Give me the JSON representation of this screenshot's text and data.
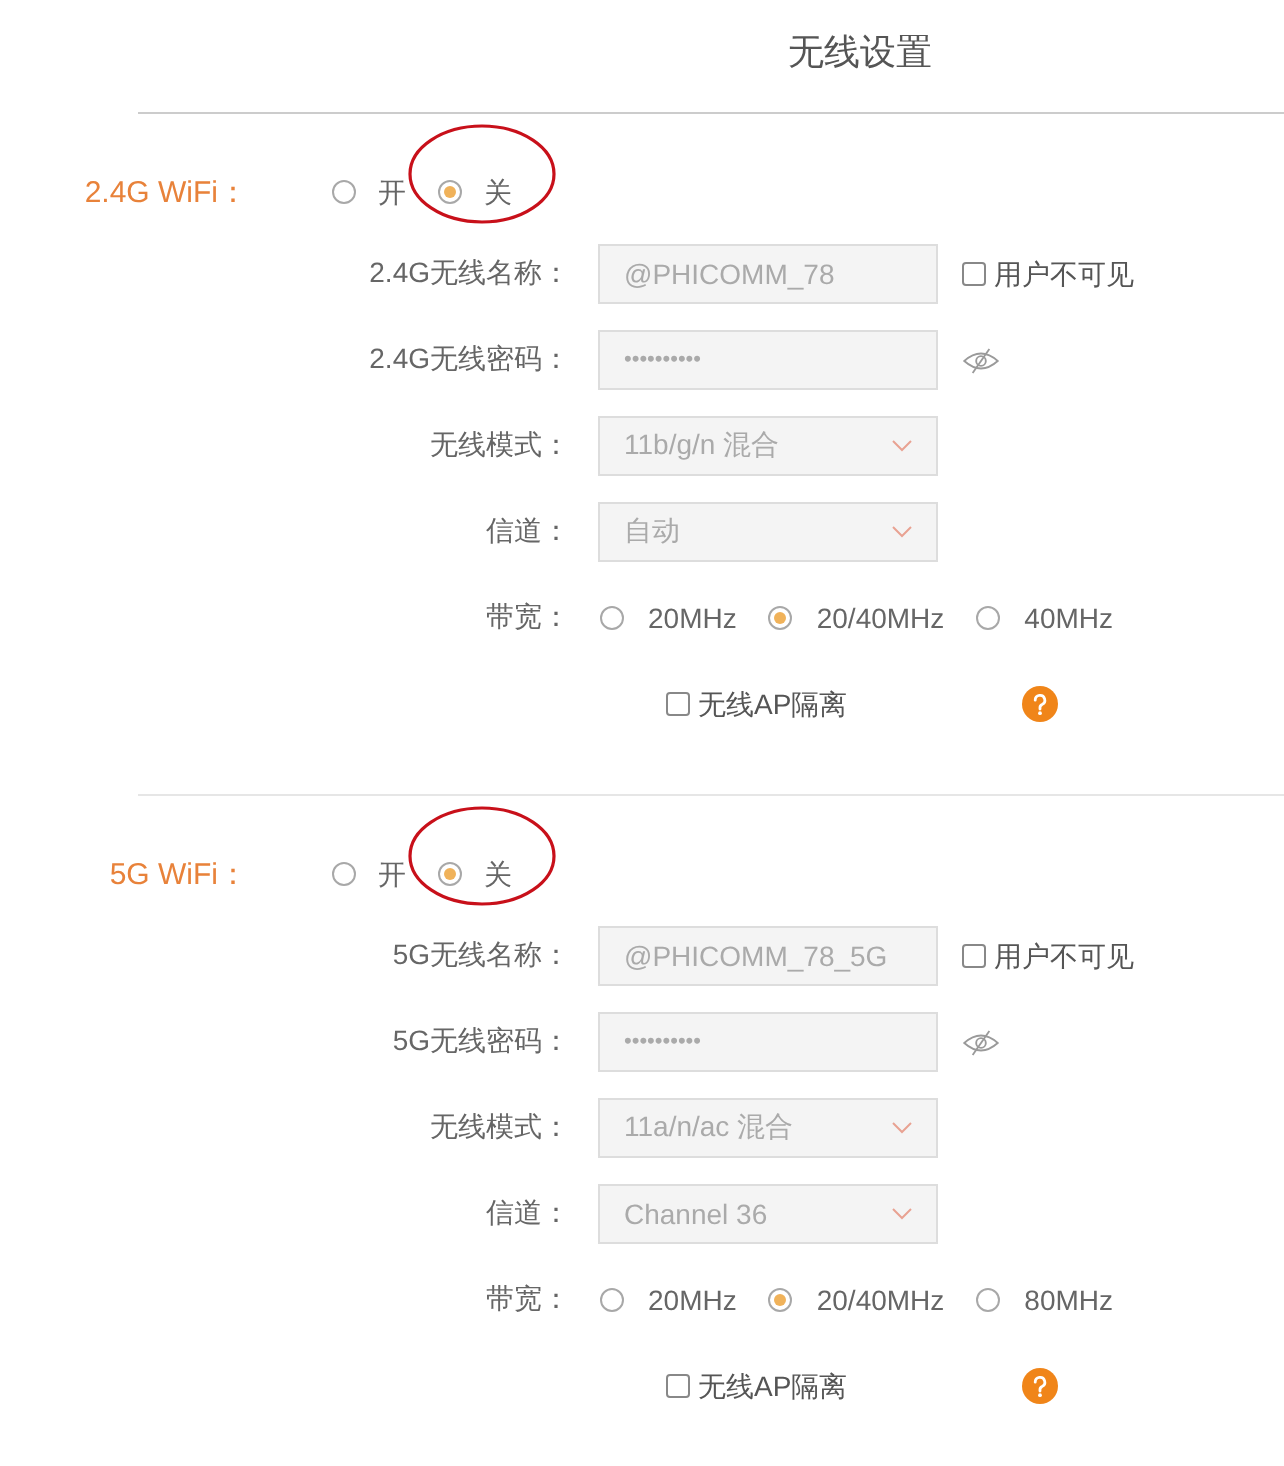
{
  "page_title": "无线设置",
  "sections": [
    {
      "label": "2.4G WiFi：",
      "power": [
        {
          "label": "开",
          "selected": false,
          "circled": false
        },
        {
          "label": "关",
          "selected": true,
          "circled": true
        }
      ],
      "fields": [
        {
          "kind": "text",
          "label": "2.4G无线名称：",
          "value": "@PHICOMM_78",
          "checkbox": {
            "label": "用户不可见",
            "checked": false
          }
        },
        {
          "kind": "password",
          "label": "2.4G无线密码：",
          "value": "••••••••••"
        },
        {
          "kind": "select",
          "label": "无线模式：",
          "value": "11b/g/n 混合"
        },
        {
          "kind": "select",
          "label": "信道：",
          "value": "自动"
        },
        {
          "kind": "radio",
          "label": "带宽：",
          "options": [
            {
              "label": "20MHz",
              "selected": false
            },
            {
              "label": "20/40MHz",
              "selected": true
            },
            {
              "label": "40MHz",
              "selected": false
            }
          ]
        },
        {
          "kind": "checkbox",
          "label": "无线AP隔离",
          "checked": false
        }
      ]
    },
    {
      "label": "5G WiFi：",
      "power": [
        {
          "label": "开",
          "selected": false,
          "circled": false
        },
        {
          "label": "关",
          "selected": true,
          "circled": true
        }
      ],
      "fields": [
        {
          "kind": "text",
          "label": "5G无线名称：",
          "value": "@PHICOMM_78_5G",
          "checkbox": {
            "label": "用户不可见",
            "checked": false
          }
        },
        {
          "kind": "password",
          "label": "5G无线密码：",
          "value": "••••••••••"
        },
        {
          "kind": "select",
          "label": "无线模式：",
          "value": "11a/n/ac 混合"
        },
        {
          "kind": "select",
          "label": "信道：",
          "value": "Channel 36"
        },
        {
          "kind": "radio",
          "label": "带宽：",
          "options": [
            {
              "label": "20MHz",
              "selected": false
            },
            {
              "label": "20/40MHz",
              "selected": true
            },
            {
              "label": "80MHz",
              "selected": false
            }
          ]
        },
        {
          "kind": "checkbox",
          "label": "无线AP隔离",
          "checked": false
        }
      ]
    }
  ]
}
